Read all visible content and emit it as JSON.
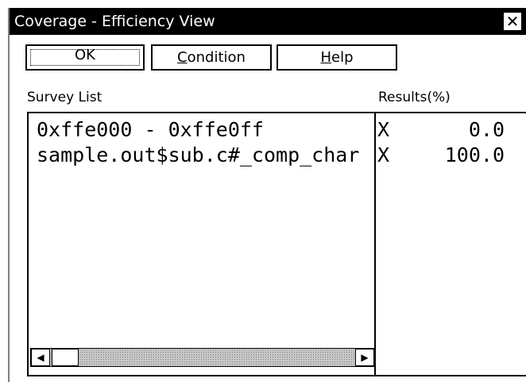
{
  "window": {
    "title": "Coverage - Efficiency View",
    "close_glyph": "✕"
  },
  "buttons": {
    "ok": "OK",
    "condition_first": "C",
    "condition_rest": "ondition",
    "help_first": "H",
    "help_rest": "elp"
  },
  "survey_list": {
    "label": "Survey List",
    "items": [
      "0xffe000 - 0xffe0ff",
      "sample.out$sub.c#_comp_char"
    ]
  },
  "results": {
    "label": "Results(%)",
    "rows": [
      {
        "flag": "X",
        "value": "0.0"
      },
      {
        "flag": "X",
        "value": "100.0"
      }
    ]
  },
  "scrollbar": {
    "left_arrow": "◀",
    "right_arrow": "▶"
  },
  "icons": {
    "close": "close-icon",
    "scroll_left": "arrow-left-icon",
    "scroll_right": "arrow-right-icon"
  }
}
